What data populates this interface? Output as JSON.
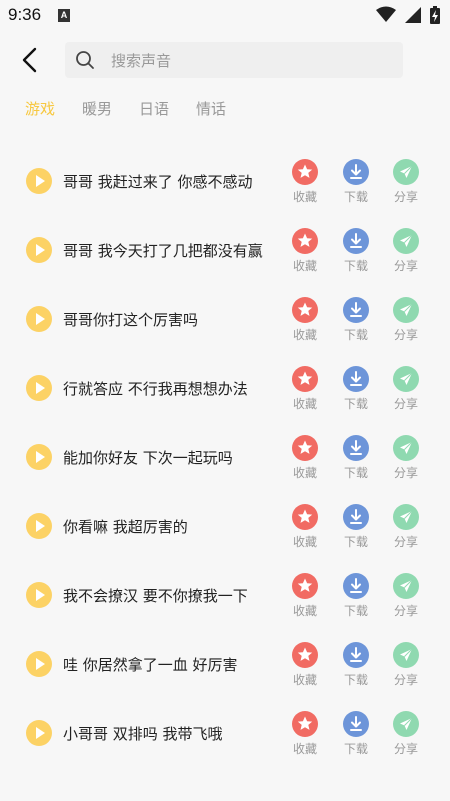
{
  "status": {
    "time": "9:36",
    "notif_badge": "A"
  },
  "search": {
    "placeholder": "搜索声音",
    "value": ""
  },
  "tabs": [
    {
      "label": "游戏",
      "active": true
    },
    {
      "label": "暖男",
      "active": false
    },
    {
      "label": "日语",
      "active": false
    },
    {
      "label": "情话",
      "active": false
    }
  ],
  "actions": {
    "favorite": "收藏",
    "download": "下载",
    "share": "分享"
  },
  "items": [
    {
      "title": "哥哥 我赶过来了 你感不感动"
    },
    {
      "title": "哥哥 我今天打了几把都没有赢"
    },
    {
      "title": "哥哥你打这个厉害吗"
    },
    {
      "title": "行就答应 不行我再想想办法"
    },
    {
      "title": "能加你好友 下次一起玩吗"
    },
    {
      "title": "你看嘛 我超厉害的"
    },
    {
      "title": "我不会撩汉 要不你撩我一下"
    },
    {
      "title": "哇 你居然拿了一血 好厉害"
    },
    {
      "title": "小哥哥 双排吗 我带飞哦"
    }
  ],
  "colors": {
    "accent": "#f7c840",
    "play": "#fcd265",
    "favorite": "#f16b63",
    "download": "#6d95d9",
    "share": "#8fd9b0"
  }
}
